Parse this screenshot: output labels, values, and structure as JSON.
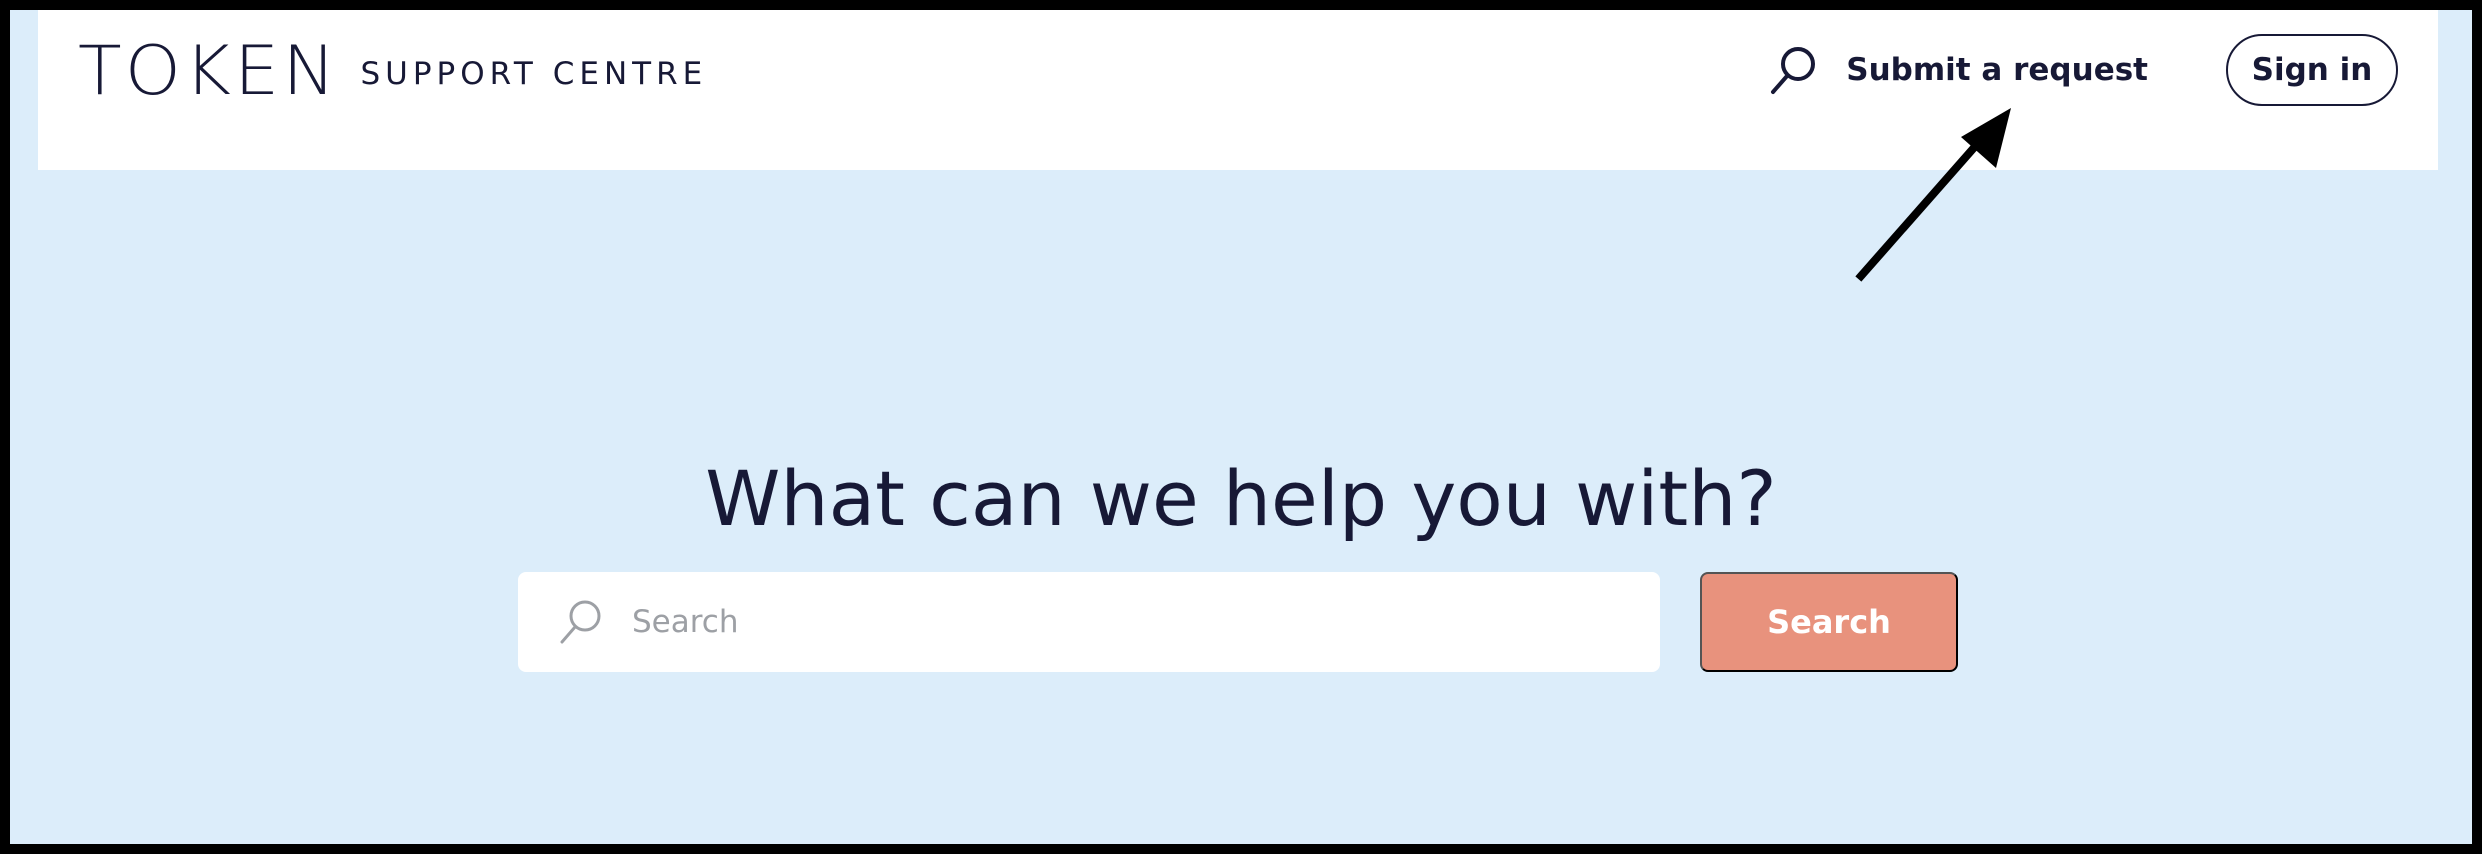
{
  "header": {
    "logo_text": "TOKEN",
    "subtitle": "SUPPORT CENTRE",
    "submit_label": "Submit a request",
    "signin_label": "Sign in",
    "search_icon": "search-icon"
  },
  "hero": {
    "title": "What can we help you with?"
  },
  "search": {
    "placeholder": "Search",
    "button_label": "Search",
    "icon": "search-icon"
  },
  "annotation": {
    "arrow": "arrow-icon"
  },
  "colors": {
    "background": "#dcedfa",
    "header": "#ffffff",
    "text": "#171936",
    "search_button": "#e8927d",
    "frame": "#000000"
  }
}
